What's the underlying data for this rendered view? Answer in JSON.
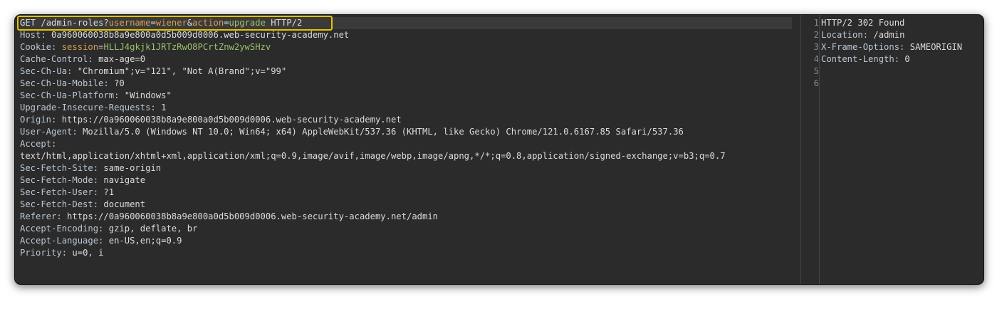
{
  "request": {
    "request_line": {
      "method": "GET",
      "path": "/admin-roles?",
      "params": [
        {
          "name": "username",
          "value": "wiener"
        },
        {
          "name": "action",
          "value": "upgrade"
        }
      ],
      "version": "HTTP/2"
    },
    "host": {
      "name": "Host:",
      "value": "0a960060038b8a9e800a0d5b009d0006.web-security-academy.net"
    },
    "cookie": {
      "name": "Cookie:",
      "param": "session",
      "value": "HLLJ4gkjk1JRTzRwO8PCrtZnw2ywSHzv"
    },
    "headers_a": [
      {
        "name": "Cache-Control:",
        "value": "max-age=0"
      },
      {
        "name": "Sec-Ch-Ua:",
        "value": "\"Chromium\";v=\"121\", \"Not A(Brand\";v=\"99\""
      },
      {
        "name": "Sec-Ch-Ua-Mobile:",
        "value": "?0"
      },
      {
        "name": "Sec-Ch-Ua-Platform:",
        "value": "\"Windows\""
      },
      {
        "name": "Upgrade-Insecure-Requests:",
        "value": "1"
      },
      {
        "name": "Origin:",
        "value": "https://0a960060038b8a9e800a0d5b009d0006.web-security-academy.net"
      },
      {
        "name": "User-Agent:",
        "value": "Mozilla/5.0 (Windows NT 10.0; Win64; x64) AppleWebKit/537.36 (KHTML, like Gecko) Chrome/121.0.6167.85 Safari/537.36"
      },
      {
        "name": "Accept:",
        "value": ""
      }
    ],
    "accept_value": "text/html,application/xhtml+xml,application/xml;q=0.9,image/avif,image/webp,image/apng,*/*;q=0.8,application/signed-exchange;v=b3;q=0.7",
    "headers_b": [
      {
        "name": "Sec-Fetch-Site:",
        "value": "same-origin"
      },
      {
        "name": "Sec-Fetch-Mode:",
        "value": "navigate"
      },
      {
        "name": "Sec-Fetch-User:",
        "value": "?1"
      },
      {
        "name": "Sec-Fetch-Dest:",
        "value": "document"
      },
      {
        "name": "Referer:",
        "value": "https://0a960060038b8a9e800a0d5b009d0006.web-security-academy.net/admin"
      },
      {
        "name": "Accept-Encoding:",
        "value": "gzip, deflate, br"
      },
      {
        "name": "Accept-Language:",
        "value": "en-US,en;q=0.9"
      },
      {
        "name": "Priority:",
        "value": "u=0, i"
      }
    ]
  },
  "response": {
    "line_numbers": [
      "1",
      "2",
      "3",
      "4",
      "5",
      "6"
    ],
    "status_line": "HTTP/2 302 Found",
    "headers": [
      {
        "name": "Location:",
        "value": "/admin"
      },
      {
        "name": "X-Frame-Options:",
        "value": "SAMEORIGIN"
      },
      {
        "name": "Content-Length:",
        "value": "0"
      }
    ]
  },
  "colors": {
    "background": "#2b2b2b",
    "header_name": "#b9c7d6",
    "param_name": "#d89f54",
    "param_value": "#9bc16b",
    "highlight_border": "#e5c200"
  }
}
